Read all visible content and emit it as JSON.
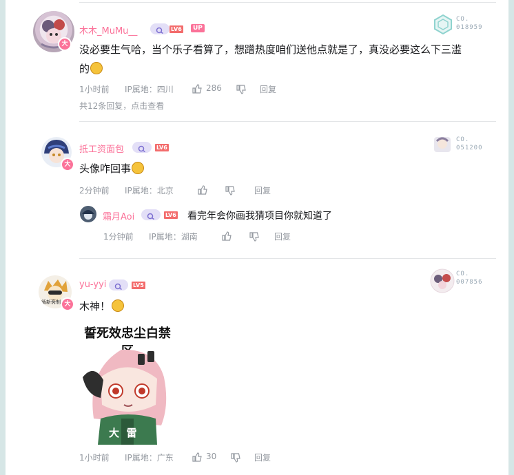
{
  "comments": [
    {
      "username": "木木_MuMu__",
      "level": "LV6",
      "up_badge": "UP",
      "fan_label": "CO.",
      "fan_number": "018959",
      "text_line1": "没必要生气哈，当个乐子看算了，想蹭热度咱们送他点就是了，真没必要这么下三滥",
      "text_line2": "的",
      "time": "1小时前",
      "ip": "IP属地：四川",
      "likes": "286",
      "reply_label": "回复",
      "reply_summary": "共12条回复，点击查看"
    },
    {
      "username": "抵工资面包",
      "level": "LV6",
      "fan_label": "CO.",
      "fan_number": "051200",
      "text": "头像咋回事",
      "time": "2分钟前",
      "ip": "IP属地：北京",
      "reply_label": "回复",
      "sub_reply": {
        "username": "霜月Aoi",
        "level": "LV6",
        "text": "看完年会你画我猜项目你就知道了",
        "time": "1分钟前",
        "ip": "IP属地：湖南",
        "reply_label": "回复"
      }
    },
    {
      "username": "yu-yyi",
      "level": "LV5",
      "fan_label": "CO.",
      "fan_number": "007856",
      "text": "木神！",
      "sticker_title": "誓死效忠尘白禁区",
      "sticker_text": "大  雷",
      "avatar_caption": "循新斋制",
      "time": "1小时前",
      "ip": "IP属地：广东",
      "likes": "30",
      "reply_label": "回复"
    }
  ],
  "badge_text": "大",
  "colors": {
    "name_pink": "#fb7299",
    "meta_gray": "#9499a0",
    "level_red": "#f36c6c",
    "search_pill": "#e3dff7"
  }
}
